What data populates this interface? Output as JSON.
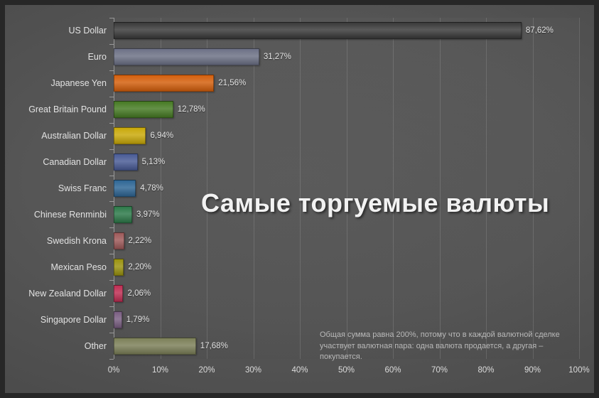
{
  "chart_data": {
    "type": "bar",
    "orientation": "horizontal",
    "title": "Самые торгуемые валюты",
    "subtitle": "",
    "xlabel": "",
    "ylabel": "",
    "xlim": [
      0,
      100
    ],
    "grid": true,
    "legend": "none",
    "value_label_suffix": "%",
    "decimal_separator": ",",
    "categories": [
      "US Dollar",
      "Euro",
      "Japanese Yen",
      "Great Britain Pound",
      "Australian Dollar",
      "Canadian Dollar",
      "Swiss Franc",
      "Chinese Renminbi",
      "Swedish Krona",
      "Mexican Peso",
      "New Zealand Dollar",
      "Singapore Dollar",
      "Other"
    ],
    "values": [
      87.62,
      31.27,
      21.56,
      12.78,
      6.94,
      5.13,
      4.78,
      3.97,
      2.22,
      2.2,
      2.06,
      1.79,
      17.68
    ],
    "value_labels": [
      "87,62%",
      "31,27%",
      "21,56%",
      "12,78%",
      "6,94%",
      "5,13%",
      "4,78%",
      "3,97%",
      "2,22%",
      "2,20%",
      "2,06%",
      "1,79%",
      "17,68%"
    ],
    "bar_colors": [
      "#3a3a3a",
      "#6d7186",
      "#d4600d",
      "#477b24",
      "#c9a90a",
      "#4a5c96",
      "#2f6795",
      "#2e7a4a",
      "#9e5a5a",
      "#9b9310",
      "#bf2f54",
      "#7a5f82",
      "#7c8059"
    ],
    "xticks": [
      "0%",
      "10%",
      "20%",
      "30%",
      "40%",
      "50%",
      "60%",
      "70%",
      "80%",
      "90%",
      "100%"
    ],
    "xtick_values": [
      0,
      10,
      20,
      30,
      40,
      50,
      60,
      70,
      80,
      90,
      100
    ],
    "annotation": "Общая сумма равна 200%, потому что в каждой валютной сделке участвует валютная пара: одна валюта продается, а другая – покупается.",
    "background_color": "#535353",
    "text_color": "#e2e2e2"
  }
}
